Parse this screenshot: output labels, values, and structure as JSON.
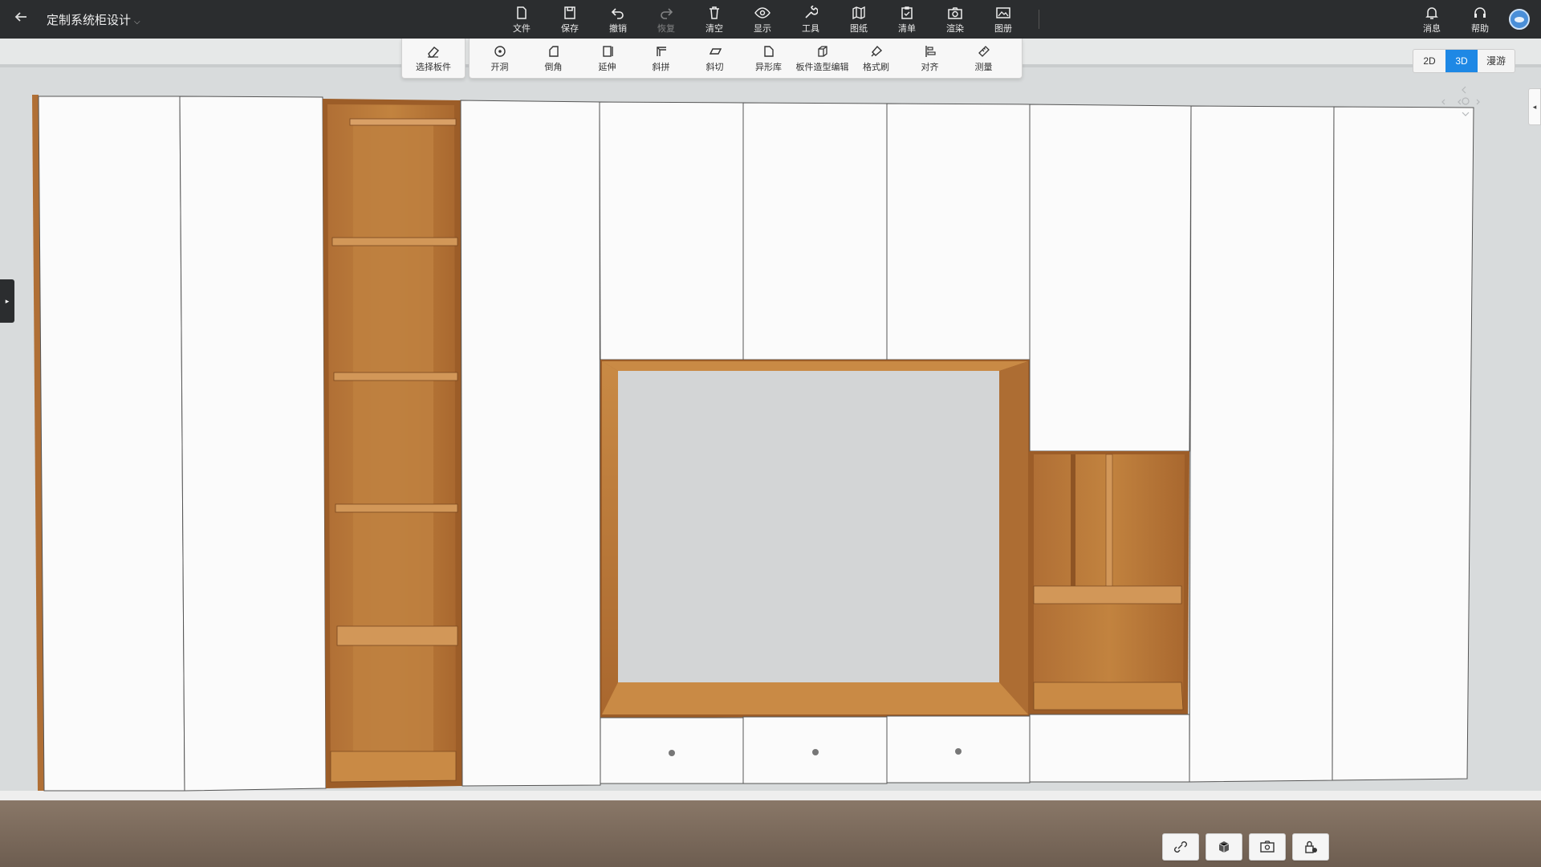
{
  "app": {
    "title": "定制系统柜设计",
    "back_icon": "arrow-left-icon"
  },
  "top_toolbar": [
    {
      "id": "file",
      "label": "文件",
      "icon": "file-icon",
      "enabled": true
    },
    {
      "id": "save",
      "label": "保存",
      "icon": "save-icon",
      "enabled": true
    },
    {
      "id": "undo",
      "label": "撤销",
      "icon": "undo-icon",
      "enabled": true
    },
    {
      "id": "redo",
      "label": "恢复",
      "icon": "redo-icon",
      "enabled": false
    },
    {
      "id": "clear",
      "label": "清空",
      "icon": "trash-icon",
      "enabled": true
    },
    {
      "id": "display",
      "label": "显示",
      "icon": "eye-icon",
      "enabled": true
    },
    {
      "id": "tools",
      "label": "工具",
      "icon": "wrench-icon",
      "enabled": true
    },
    {
      "id": "drawings",
      "label": "图纸",
      "icon": "map-icon",
      "enabled": true
    },
    {
      "id": "list",
      "label": "清单",
      "icon": "clipboard-icon",
      "enabled": true
    },
    {
      "id": "render",
      "label": "渲染",
      "icon": "camera-icon",
      "enabled": true
    },
    {
      "id": "album",
      "label": "图册",
      "icon": "image-icon",
      "enabled": true
    }
  ],
  "top_right": [
    {
      "id": "messages",
      "label": "消息",
      "icon": "bell-icon"
    },
    {
      "id": "help",
      "label": "帮助",
      "icon": "headset-icon"
    }
  ],
  "sub_toolbar": [
    {
      "id": "select-board",
      "label": "选择板件",
      "icon": "eraser-select-icon"
    },
    {
      "id": "open-hole",
      "label": "开洞",
      "icon": "circle-dot-icon"
    },
    {
      "id": "chamfer",
      "label": "倒角",
      "icon": "chamfer-icon"
    },
    {
      "id": "extend",
      "label": "延伸",
      "icon": "extend-icon"
    },
    {
      "id": "miter-join",
      "label": "斜拼",
      "icon": "miter-join-icon"
    },
    {
      "id": "bevel-cut",
      "label": "斜切",
      "icon": "bevel-cut-icon"
    },
    {
      "id": "shape-library",
      "label": "异形库",
      "icon": "shape-library-icon"
    },
    {
      "id": "board-shape-edit",
      "label": "板件造型编辑",
      "icon": "cube-edit-icon"
    },
    {
      "id": "format-brush",
      "label": "格式刷",
      "icon": "format-brush-icon"
    },
    {
      "id": "align",
      "label": "对齐",
      "icon": "align-icon"
    },
    {
      "id": "measure",
      "label": "测量",
      "icon": "ruler-icon"
    }
  ],
  "view_modes": [
    {
      "id": "2d",
      "label": "2D",
      "active": false
    },
    {
      "id": "3d",
      "label": "3D",
      "active": true
    },
    {
      "id": "walk",
      "label": "漫游",
      "active": false
    }
  ],
  "bottom_tools": [
    {
      "id": "link-tool",
      "icon": "link-check-icon"
    },
    {
      "id": "cube-view",
      "icon": "cube-icon"
    },
    {
      "id": "screenshot",
      "icon": "screenshot-icon"
    },
    {
      "id": "lock-tool",
      "icon": "lock-check-icon"
    }
  ],
  "colors": {
    "topbar": "#2b2d2f",
    "accent": "#1e88e5",
    "panel_white": "#fbfbfb",
    "wood": "#b9773c",
    "wall": "#d6d9da",
    "floor": "#7b6a5c"
  }
}
